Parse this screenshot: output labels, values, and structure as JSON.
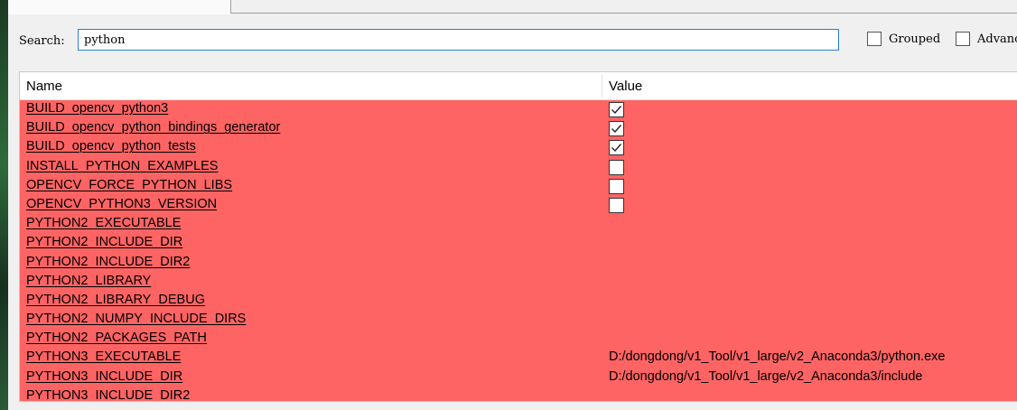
{
  "search": {
    "label": "Search:",
    "value": "python"
  },
  "options": {
    "grouped": {
      "label": "Grouped",
      "checked": false
    },
    "advanced": {
      "label": "Advanc",
      "checked": false
    }
  },
  "table": {
    "headers": {
      "name": "Name",
      "value": "Value"
    },
    "row_color": "#ff6464",
    "rows": [
      {
        "name": "BUILD_opencv_python3",
        "type": "bool",
        "checked": true
      },
      {
        "name": "BUILD_opencv_python_bindings_generator",
        "type": "bool",
        "checked": true
      },
      {
        "name": "BUILD_opencv_python_tests",
        "type": "bool",
        "checked": true
      },
      {
        "name": "INSTALL_PYTHON_EXAMPLES",
        "type": "bool",
        "checked": false
      },
      {
        "name": "OPENCV_FORCE_PYTHON_LIBS",
        "type": "bool",
        "checked": false
      },
      {
        "name": "OPENCV_PYTHON3_VERSION",
        "type": "bool",
        "checked": false
      },
      {
        "name": "PYTHON2_EXECUTABLE",
        "type": "text",
        "value": ""
      },
      {
        "name": "PYTHON2_INCLUDE_DIR",
        "type": "text",
        "value": ""
      },
      {
        "name": "PYTHON2_INCLUDE_DIR2",
        "type": "text",
        "value": ""
      },
      {
        "name": "PYTHON2_LIBRARY",
        "type": "text",
        "value": ""
      },
      {
        "name": "PYTHON2_LIBRARY_DEBUG",
        "type": "text",
        "value": ""
      },
      {
        "name": "PYTHON2_NUMPY_INCLUDE_DIRS",
        "type": "text",
        "value": ""
      },
      {
        "name": "PYTHON2_PACKAGES_PATH",
        "type": "text",
        "value": ""
      },
      {
        "name": "PYTHON3_EXECUTABLE",
        "type": "text",
        "value": "D:/dongdong/v1_Tool/v1_large/v2_Anaconda3/python.exe"
      },
      {
        "name": "PYTHON3_INCLUDE_DIR",
        "type": "text",
        "value": "D:/dongdong/v1_Tool/v1_large/v2_Anaconda3/include"
      },
      {
        "name": "PYTHON3_INCLUDE_DIR2",
        "type": "text",
        "value": ""
      }
    ]
  }
}
